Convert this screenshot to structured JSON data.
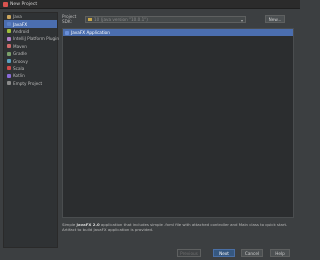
{
  "window": {
    "title": "New Project"
  },
  "sidebar": {
    "items": [
      {
        "label": "Java",
        "color": "#c9a45c"
      },
      {
        "label": "JavaFX",
        "color": "#5a7fc4"
      },
      {
        "label": "Android",
        "color": "#9fbf3a"
      },
      {
        "label": "IntelliJ Platform Plugin",
        "color": "#b080c8"
      },
      {
        "label": "Maven",
        "color": "#d06a6a"
      },
      {
        "label": "Gradle",
        "color": "#7aa06a"
      },
      {
        "label": "Groovy",
        "color": "#5aa0c0"
      },
      {
        "label": "Scala",
        "color": "#d04a4a"
      },
      {
        "label": "Kotlin",
        "color": "#8a6ad8"
      },
      {
        "label": "Empty Project",
        "color": "#8a8a8a"
      }
    ],
    "selected_index": 1
  },
  "sdk": {
    "label": "Project SDK:",
    "value": "10 (java version \"10.0.1\")",
    "new_button": "New..."
  },
  "templates": [
    "JavaFX Application"
  ],
  "description": {
    "part1": "Simple ",
    "bold": "JavaFX 2.0",
    "part2": " application that includes simple .fxml file with attached controller and Main class to quick start. Artifact to build JavaFX application is provided."
  },
  "footer": {
    "previous": "Previous",
    "next": "Next",
    "cancel": "Cancel",
    "help": "Help"
  }
}
